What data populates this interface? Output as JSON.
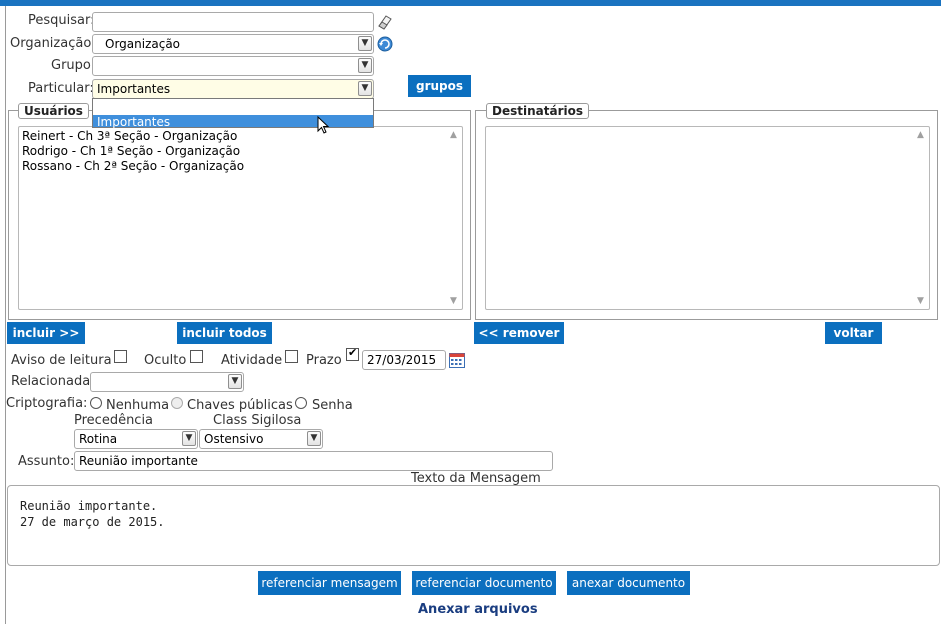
{
  "form": {
    "pesquisar_label": "Pesquisar:",
    "pesquisar_value": "",
    "organizacao_label": "Organização:",
    "organizacao_value": "Organização",
    "grupo_label": "Grupo:",
    "grupo_value": "",
    "particular_label": "Particular:",
    "particular_value": "Importantes",
    "grupos_button": "grupos",
    "particular_dropdown": {
      "options": [
        "",
        "Importantes"
      ],
      "highlighted_index": 1
    }
  },
  "usuarios": {
    "legend": "Usuários",
    "items": [
      "Reinert - Ch 3ª Seção - Organização",
      "Rodrigo - Ch 1ª Seção - Organização",
      "Rossano - Ch 2ª Seção - Organização"
    ]
  },
  "destinatarios": {
    "legend": "Destinatários",
    "items": []
  },
  "buttons": {
    "incluir": "incluir >>",
    "incluir_todos": "incluir todos",
    "remover": "<< remover",
    "voltar": "voltar"
  },
  "options": {
    "aviso_label": "Aviso de leitura",
    "aviso_checked": false,
    "oculto_label": "Oculto",
    "oculto_checked": false,
    "atividade_label": "Atividade",
    "atividade_checked": false,
    "prazo_label": "Prazo",
    "prazo_checked": true,
    "prazo_date": "27/03/2015",
    "relacionada_label": "Relacionada:",
    "relacionada_value": "",
    "cripto_label": "Criptografia:",
    "cripto_options": [
      "Nenhuma",
      "Chaves públicas",
      "Senha"
    ],
    "precedencia_label": "Precedência",
    "precedencia_value": "Rotina",
    "class_label": "Class Sigilosa",
    "class_value": "Ostensivo",
    "assunto_label": "Assunto:",
    "assunto_value": "Reunião importante",
    "texto_label": "Texto da Mensagem"
  },
  "message": {
    "line1": "Reunião importante.",
    "line2": "27 de março de 2015."
  },
  "bottom": {
    "ref_msg": "referenciar mensagem",
    "ref_doc": "referenciar documento",
    "anexar_doc": "anexar documento",
    "anexar_arquivos": "Anexar arquivos"
  },
  "colors": {
    "accent": "#0b6fbf",
    "highlight": "#3f8fdc"
  },
  "icons": {
    "eraser": "eraser-icon",
    "refresh": "refresh-icon",
    "calendar": "calendar-icon",
    "cursor": "mouse-pointer-icon"
  }
}
